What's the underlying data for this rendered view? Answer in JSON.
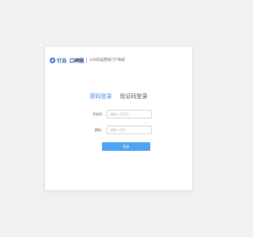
{
  "header": {
    "logo_text": "钉选",
    "brand": "口碑圈",
    "portal_name": "公众的运营商门户系统"
  },
  "tabs": [
    {
      "label": "密码登录",
      "active": true
    },
    {
      "label": "验证码登录",
      "active": false
    }
  ],
  "form": {
    "phone_label": "手机号:",
    "phone_placeholder": "请输入手机号",
    "password_label": "密码:",
    "password_placeholder": "请输入密码",
    "submit_label": "登录"
  },
  "colors": {
    "accent": "#3d8bea",
    "button": "#4ea3f3",
    "background": "#f1f1f1"
  }
}
